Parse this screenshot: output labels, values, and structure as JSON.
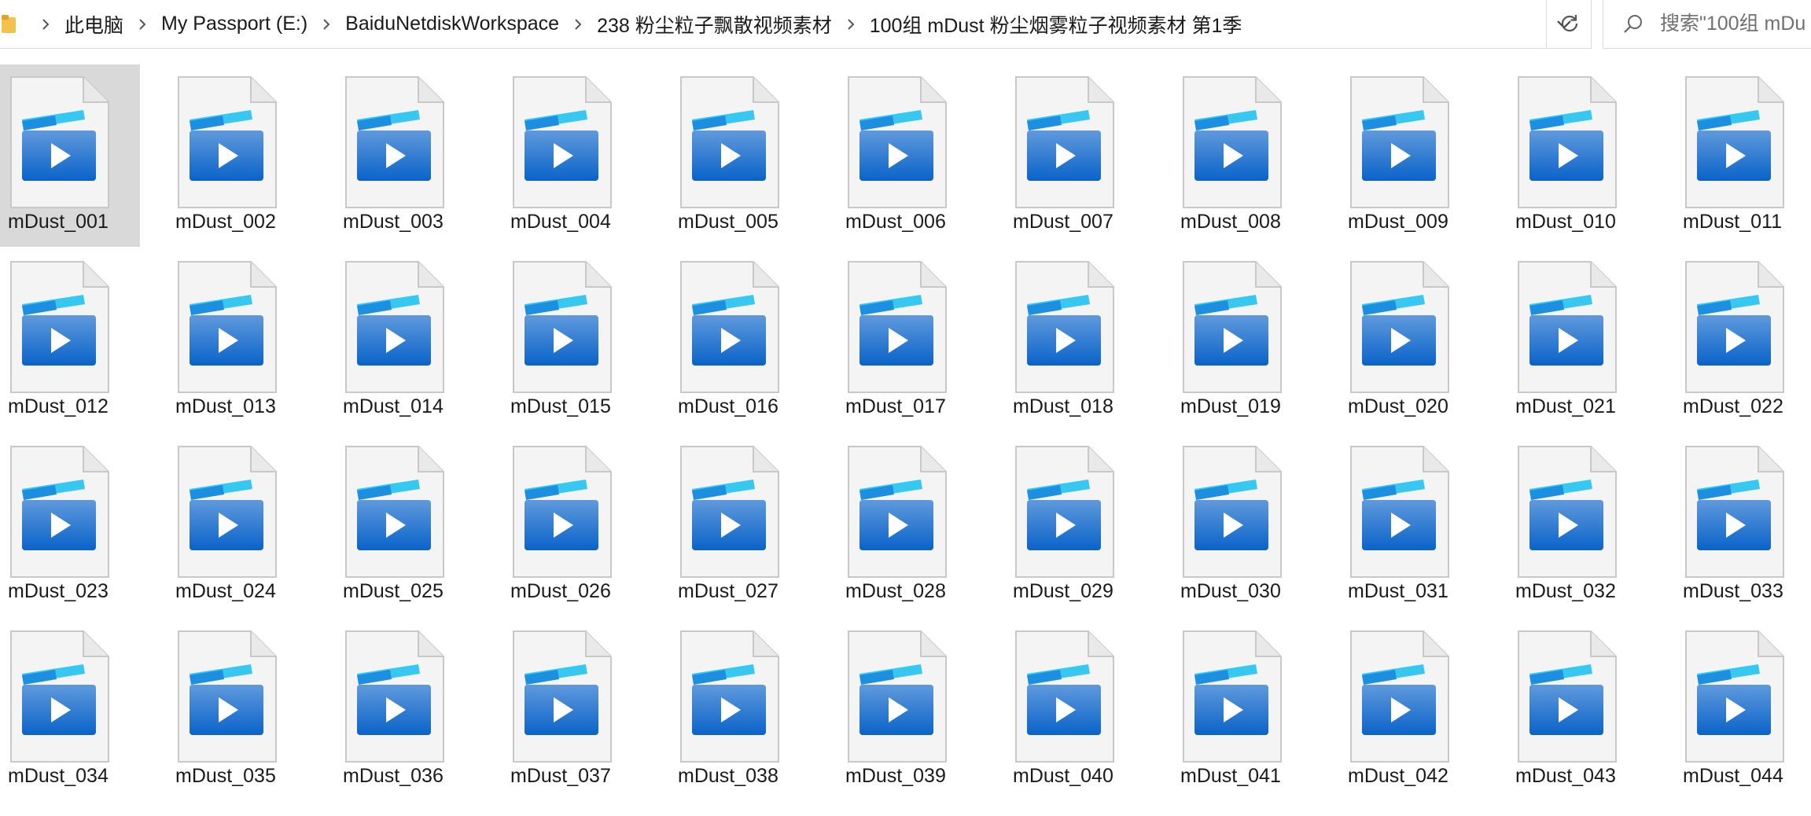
{
  "address": {
    "crumbs": [
      "此电脑",
      "My Passport (E:)",
      "BaiduNetdiskWorkspace",
      "238 粉尘粒子飘散视频素材",
      "100组 mDust 粉尘烟雾粒子视频素材 第1季"
    ]
  },
  "search": {
    "placeholder": "搜索\"100组 mDu"
  },
  "icons": {
    "folder": "folder-icon",
    "separator": "chevron-right-icon",
    "dropdown": "chevron-down-icon",
    "refresh": "refresh-icon",
    "search": "search-icon",
    "file": "video-file-icon"
  },
  "colors": {
    "selection": "#d9d9d9",
    "video_blue": "#0a63c9",
    "video_cyan": "#37c8f2"
  },
  "files": [
    "mDust_001",
    "mDust_002",
    "mDust_003",
    "mDust_004",
    "mDust_005",
    "mDust_006",
    "mDust_007",
    "mDust_008",
    "mDust_009",
    "mDust_010",
    "mDust_011",
    "mDust_012",
    "mDust_013",
    "mDust_014",
    "mDust_015",
    "mDust_016",
    "mDust_017",
    "mDust_018",
    "mDust_019",
    "mDust_020",
    "mDust_021",
    "mDust_022",
    "mDust_023",
    "mDust_024",
    "mDust_025",
    "mDust_026",
    "mDust_027",
    "mDust_028",
    "mDust_029",
    "mDust_030",
    "mDust_031",
    "mDust_032",
    "mDust_033",
    "mDust_034",
    "mDust_035",
    "mDust_036",
    "mDust_037",
    "mDust_038",
    "mDust_039",
    "mDust_040",
    "mDust_041",
    "mDust_042",
    "mDust_043",
    "mDust_044"
  ],
  "selected_file": "mDust_001"
}
